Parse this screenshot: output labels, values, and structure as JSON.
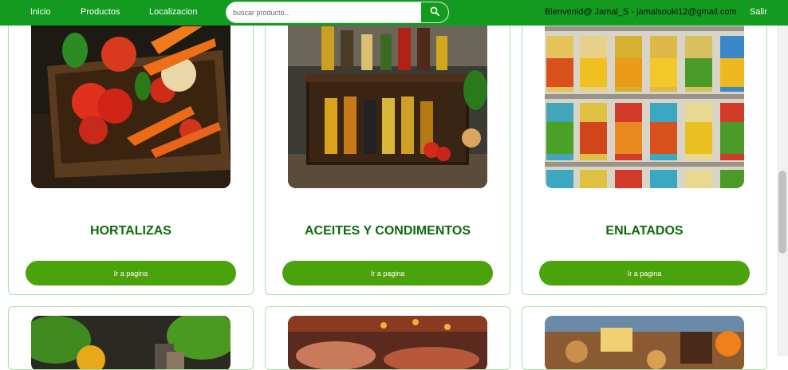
{
  "nav": {
    "links": [
      "Inicio",
      "Productos",
      "Localizacion"
    ],
    "search_placeholder": "buscar producto...",
    "search_icon": "search-icon",
    "welcome": "Bienvenid@ Jamal_S - jamalsouki12@gmail.com",
    "logout": "Salir"
  },
  "categories": [
    {
      "title": "HORTALIZAS",
      "button": "Ir a pagina",
      "image": "vegetables-crate"
    },
    {
      "title": "ACEITES Y CONDIMENTOS",
      "button": "Ir a pagina",
      "image": "oil-bottles"
    },
    {
      "title": "ENLATADOS",
      "button": "Ir a pagina",
      "image": "canned-goods"
    }
  ],
  "colors": {
    "navbar": "#139b1f",
    "title": "#0c6b0c",
    "button": "#4aa30a",
    "card_border": "#a8e0a8"
  }
}
